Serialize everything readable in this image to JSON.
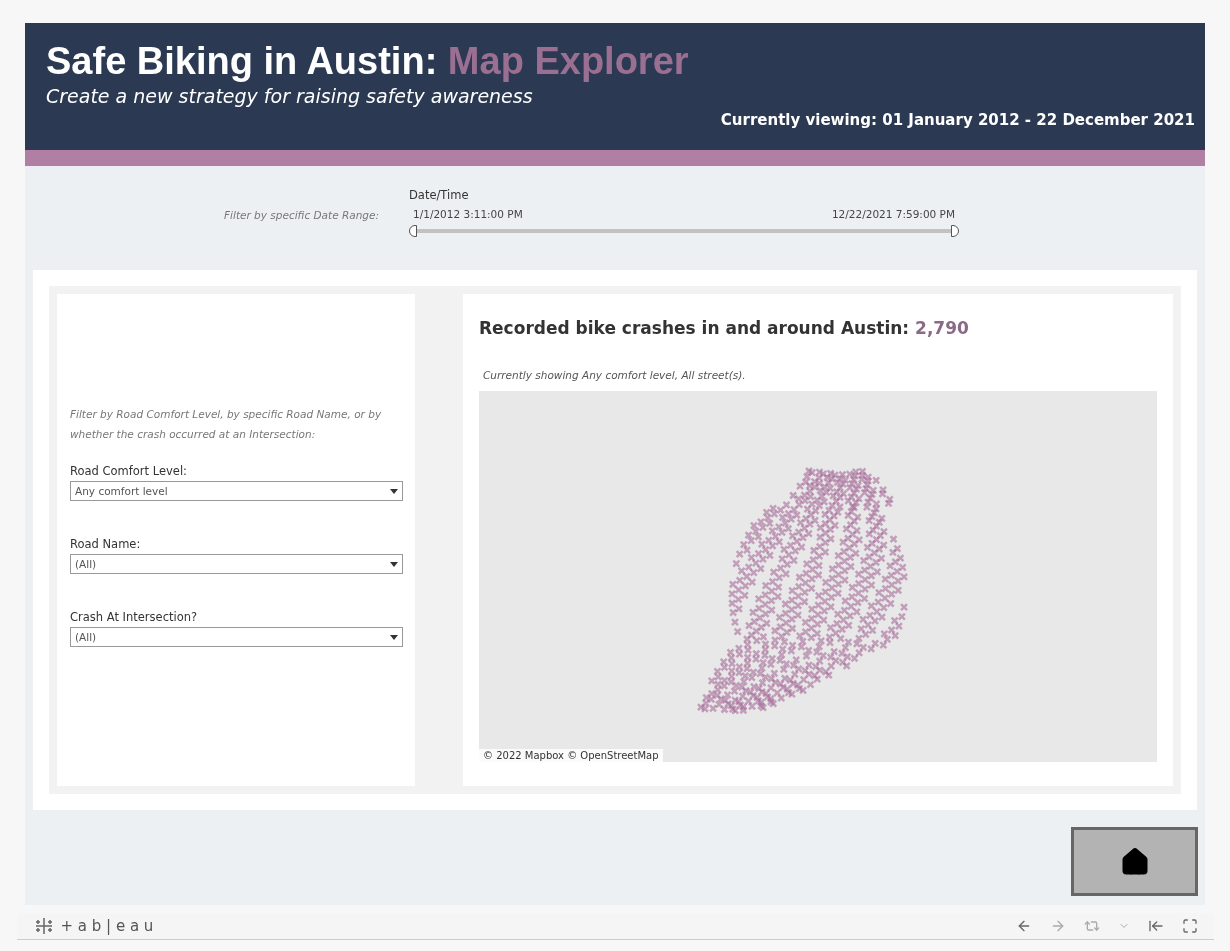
{
  "header": {
    "title": "Safe Biking in Austin:",
    "title_accent": "Map Explorer",
    "subtitle": "Create a new strategy for raising safety awareness",
    "viewing": "Currently viewing: 01 January 2012 - 22 December 2021"
  },
  "date_filter": {
    "hint": "Filter by specific Date Range:",
    "label": "Date/Time",
    "start": "1/1/2012 3:11:00 PM",
    "end": "12/22/2021 7:59:00 PM",
    "level": 1
  },
  "filters": {
    "hint": "Filter by Road Comfort Level, by specific Road Name, or by whether the crash occurred at an Intersection:",
    "items": [
      {
        "label": "Road Comfort Level:",
        "value": "Any comfort level"
      },
      {
        "label": "Road Name:",
        "value": "(All)"
      },
      {
        "label": "Crash At Intersection?",
        "value": "(All)"
      }
    ]
  },
  "map_panel": {
    "title": "Recorded bike crashes in and around Austin:",
    "count": "2,790",
    "caption": "Currently showing Any comfort level, All street(s).",
    "attribution": "© 2022 Mapbox © OpenStreetMap"
  },
  "footer": {
    "logo": "+ a b | e a u"
  }
}
